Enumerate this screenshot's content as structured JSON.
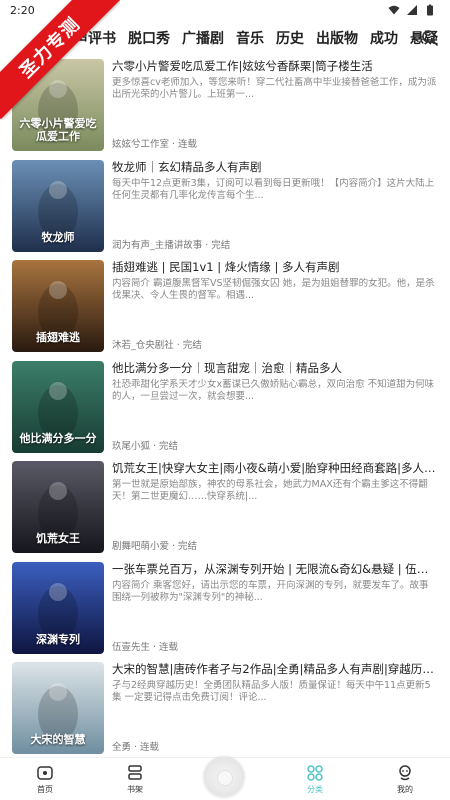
{
  "status_bar": {
    "time": "2:20"
  },
  "watermark": {
    "text": "圣力专测"
  },
  "categories": [
    "相声评书",
    "脱口秀",
    "广播剧",
    "音乐",
    "历史",
    "出版物",
    "成功",
    "悬疑"
  ],
  "items": [
    {
      "title": "六零小片警爱吃瓜爱工作|妶妶兮香酥栗|筒子楼生活",
      "desc": "更多惊喜cv老师加入，等您来听！穿二代社畜高中毕业接替爸爸工作，成为派出所光荣的小片警儿。上班第一...",
      "meta": "妶妶兮工作室 · 连载",
      "cover_text": "六零小片警爱吃瓜爱工作",
      "colors": [
        "#c9c7a6",
        "#7a8b5c"
      ]
    },
    {
      "title": "牧龙师｜玄幻精品多人有声剧",
      "desc": "每天中午12点更新3集，订阅可以看到每日更新哦！【内容简介】这片大陆上任何生灵都有几率化龙传言每个生...",
      "meta": "润为有声_主播讲故事 · 完结",
      "cover_text": "牧龙师",
      "colors": [
        "#6b90b5",
        "#1f2f4d"
      ]
    },
    {
      "title": "插翅难逃 | 民国1v1 | 烽火情缘 | 多人有声剧",
      "desc": "内容简介 霸道腹黑督军VS坚韧倔强女囚 她，是为姐姐替罪的女犯。他，是杀伐果决、令人生畏的督军。相遇...",
      "meta": "沐若_仓央剧社 · 完结",
      "cover_text": "插翅难逃",
      "colors": [
        "#a8743f",
        "#2a1a10"
      ]
    },
    {
      "title": "他比满分多一分｜现言甜宠｜治愈｜精品多人",
      "desc": "社恐乖甜化学系天才少女x蓄谋已久傲娇贴心霸总，双向治愈 不知道甜为何味的人，一旦尝过一次，就会想要...",
      "meta": "玖尾小狐 · 完结",
      "cover_text": "他比满分多一分",
      "colors": [
        "#3c7e6a",
        "#183c33"
      ]
    },
    {
      "title": "饥荒女王|快穿大女主|雨小夜&萌小爱|胎穿种田经商套路|多人有声剧",
      "desc": "第一世就是原始部族，神农的母系社会，她武力MAX还有个霸主爹这不得翻天！第二世更魔幻……快穿系统|...",
      "meta": "剧舞吧萌小爱 · 完结",
      "cover_text": "饥荒女王",
      "colors": [
        "#5a5a66",
        "#15151c"
      ]
    },
    {
      "title": "一张车票兑百万，从深渊专列开始 | 无限流&奇幻&悬疑 | 伍壹先生 | 多人有声剧",
      "desc": "内容简介 乘客您好，请出示您的车票，开向深渊的专列，就要发车了。故事围绕一列被称为\"深渊专列\"的神秘...",
      "meta": "伍壹先生 · 连载",
      "cover_text": "深渊专列",
      "colors": [
        "#3b5fbf",
        "#0f1540"
      ]
    },
    {
      "title": "大宋的智慧|唐砖作者孑与2作品|全勇|精品多人有声剧|穿越历史 | 权谋",
      "desc": "孑与2经典穿越历史！全勇团队精品多人版！质量保证！每天中午11点更新5集 一定要记得点击免费订阅！评论...",
      "meta": "全勇 · 连载",
      "cover_text": "大宋的智慧",
      "colors": [
        "#dce4e8",
        "#6f8ea0"
      ]
    }
  ],
  "bottom_nav": [
    {
      "label": "首页",
      "icon": "home-icon"
    },
    {
      "label": "书架",
      "icon": "bookshelf-icon"
    },
    {
      "label": "分类",
      "icon": "category-icon",
      "active": true
    },
    {
      "label": "我的",
      "icon": "profile-icon"
    }
  ],
  "accent_color": "#4fc3c8"
}
